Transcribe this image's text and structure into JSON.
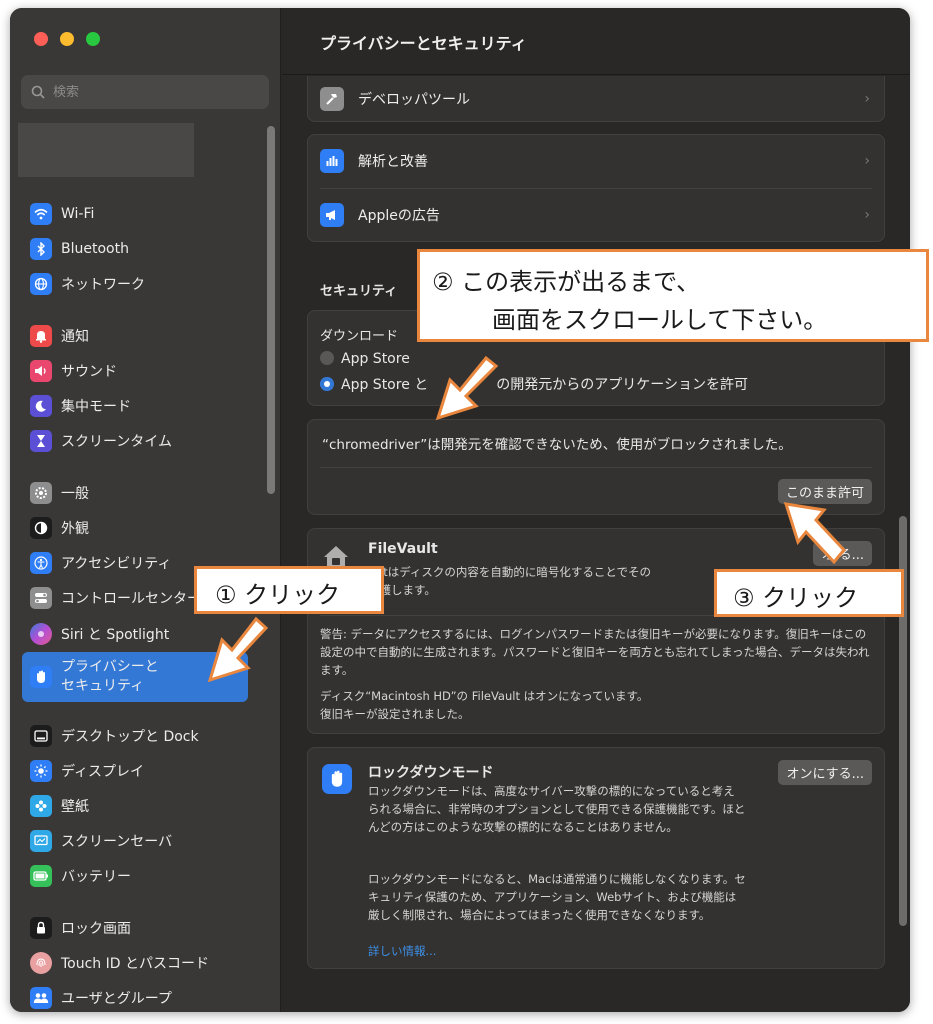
{
  "window": {
    "title": "プライバシーとセキュリティ"
  },
  "search": {
    "placeholder": "検索"
  },
  "sidebar": {
    "items": [
      {
        "label": "Wi-Fi",
        "icon": "wifi-icon",
        "color": "#2f7ef6"
      },
      {
        "label": "Bluetooth",
        "icon": "bluetooth-icon",
        "color": "#2f7ef6"
      },
      {
        "label": "ネットワーク",
        "icon": "globe-icon",
        "color": "#2f7ef6"
      },
      {
        "label": "通知",
        "icon": "bell-icon",
        "color": "#ef4a4a"
      },
      {
        "label": "サウンド",
        "icon": "speaker-icon",
        "color": "#e9476d"
      },
      {
        "label": "集中モード",
        "icon": "moon-icon",
        "color": "#5b4fd6"
      },
      {
        "label": "スクリーンタイム",
        "icon": "hourglass-icon",
        "color": "#5b4fd6"
      },
      {
        "label": "一般",
        "icon": "gear-icon",
        "color": "#8e8e8e"
      },
      {
        "label": "外観",
        "icon": "appearance-icon",
        "color": "#1c1c1c"
      },
      {
        "label": "アクセシビリティ",
        "icon": "accessibility-icon",
        "color": "#2f7ef6"
      },
      {
        "label": "コントロールセンター",
        "icon": "control-center-icon",
        "color": "#8e8e8e"
      },
      {
        "label": "Siri と Spotlight",
        "icon": "siri-icon",
        "color": "#b34fd6"
      },
      {
        "label1": "プライバシーと",
        "label2": "セキュリティ",
        "icon": "hand-icon",
        "color": "#2f7ef6"
      },
      {
        "label": "デスクトップと Dock",
        "icon": "desktop-icon",
        "color": "#1c1c1c"
      },
      {
        "label": "ディスプレイ",
        "icon": "sun-icon",
        "color": "#2f7ef6"
      },
      {
        "label": "壁紙",
        "icon": "wallpaper-icon",
        "color": "#2fa8e8"
      },
      {
        "label": "スクリーンセーバ",
        "icon": "screensaver-icon",
        "color": "#2fa8e8"
      },
      {
        "label": "バッテリー",
        "icon": "battery-icon",
        "color": "#36c05a"
      },
      {
        "label": "ロック画面",
        "icon": "lock-icon",
        "color": "#1c1c1c"
      },
      {
        "label": "Touch ID とパスコード",
        "icon": "fingerprint-icon",
        "color": "#e9a0a0"
      },
      {
        "label": "ユーザとグループ",
        "icon": "users-icon",
        "color": "#2f7ef6"
      }
    ]
  },
  "main": {
    "dev_tools": "デベロッパツール",
    "analytics": "解析と改善",
    "apple_ads": "Appleの広告",
    "security_title": "セキュリティ",
    "downloads_label": "ダウンロード",
    "opt_app_store": "App Store",
    "opt_app_store_dev": "App Store と",
    "opt_app_store_dev_tail": "の開発元からのアプリケーションを許可",
    "blocked_message": "“chromedriver”は開発元を確認できないため、使用がブロックされました。",
    "allow_anyway": "このまま許可",
    "filevault_title": "FileVault",
    "filevault_desc1": "ltはディスクの内容を自動的に暗号化することでその",
    "filevault_desc2": "保護します。",
    "filevault_button": "オ     る...",
    "warning": "警告: データにアクセスするには、ログインパスワードまたは復旧キーが必要になります。復旧キーはこの設定の中で自動的に生成されます。パスワードと復旧キーを両方とも忘れてしまった場合、データは失われます。",
    "disk_status1": "ディスク“Macintosh HD”の FileVault はオンになっています。",
    "disk_status2": "復旧キーが設定されました。",
    "lockdown_title": "ロックダウンモード",
    "lockdown_button": "オンにする...",
    "lockdown_desc1": "ロックダウンモードは、高度なサイバー攻撃の標的になっていると考えられる場合に、非常時のオプションとして使用できる保護機能です。ほとんどの方はこのような攻撃の標的になることはありません。",
    "lockdown_desc2": "ロックダウンモードになると、Macは通常通りに機能しなくなります。セキュリティ保護のため、アプリケーション、Webサイト、および機能は厳しく制限され、場合によってはまったく使用できなくなります。",
    "more_info": "詳しい情報..."
  },
  "callouts": {
    "step1": "① クリック",
    "step2_line1": "② この表示が出るまで、",
    "step2_line2": "画面をスクロールして下さい。",
    "step3": "③ クリック"
  },
  "colors": {
    "accent": "#3478d6",
    "callout_border": "#e8873d"
  }
}
